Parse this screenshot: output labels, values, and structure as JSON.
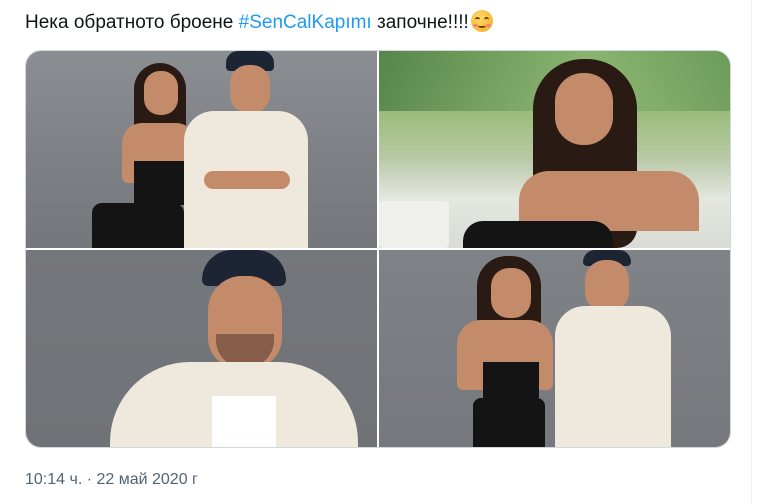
{
  "tweet": {
    "text_before": "Нека обратното броене ",
    "hashtag": "#SenCalKapımı",
    "text_after": " започне!!!!",
    "emoji": "smiling-face-with-blush"
  },
  "media": {
    "photos": [
      {
        "subject": "couple-standing"
      },
      {
        "subject": "woman-seated-outdoors"
      },
      {
        "subject": "man-in-cap-portrait"
      },
      {
        "subject": "couple-smiling"
      }
    ]
  },
  "meta": {
    "timestamp": "10:14 ч. · 22 май 2020 г"
  },
  "colors": {
    "link": "#1d9bf0",
    "text": "#0f1419",
    "muted": "#536471",
    "border": "#cfd9de"
  }
}
